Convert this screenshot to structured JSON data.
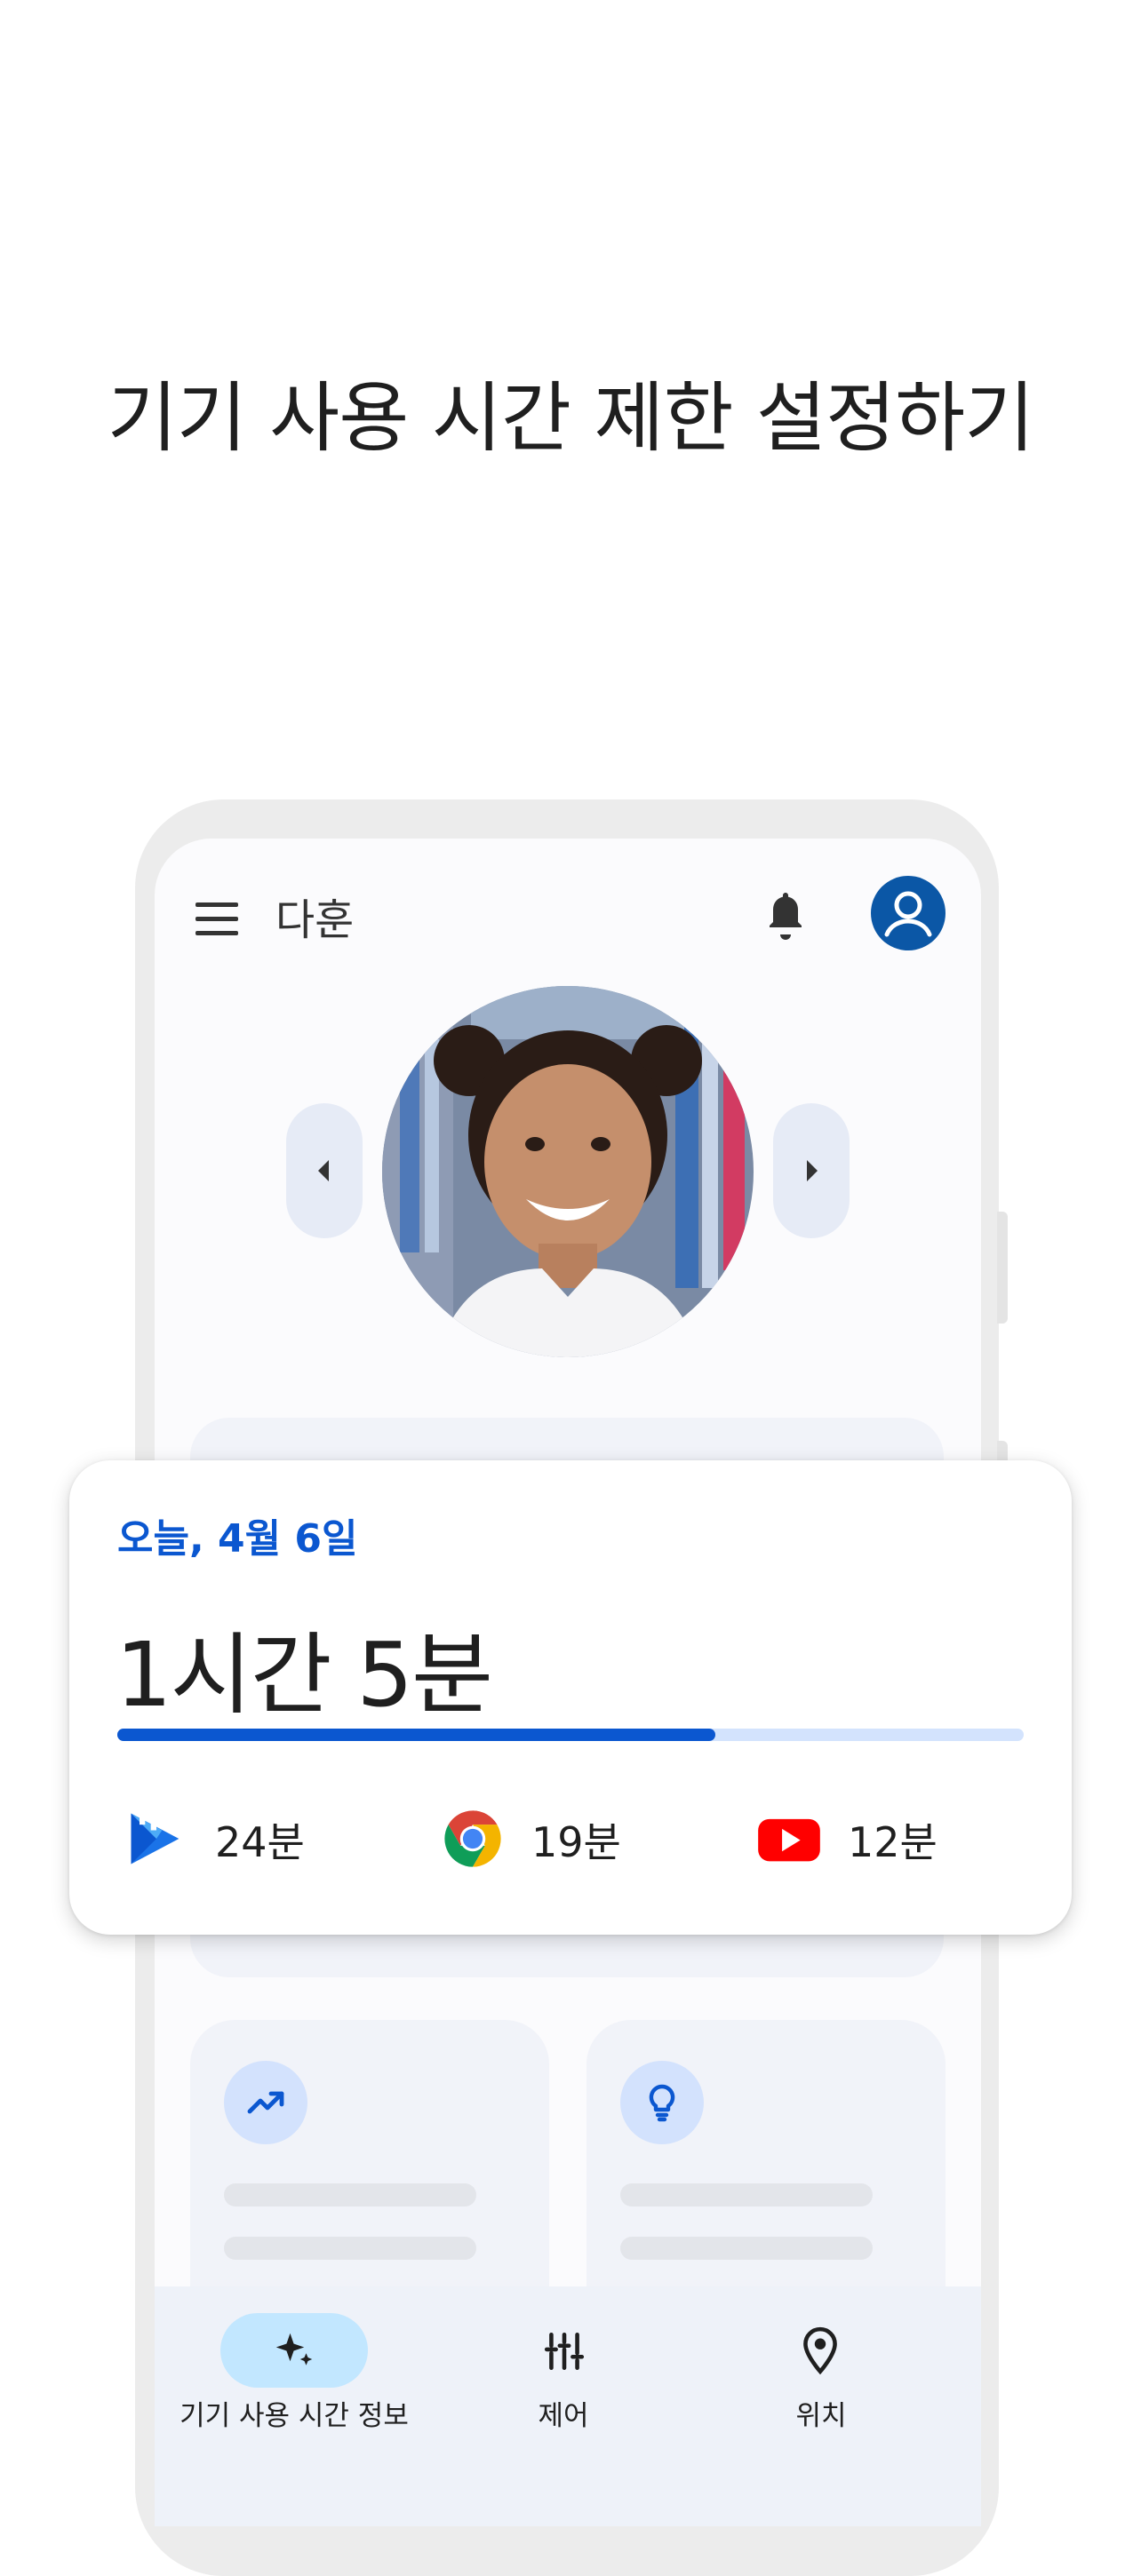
{
  "headline": "기기 사용 시간 제한 설정하기",
  "app_bar": {
    "child_name": "다훈",
    "bell_icon": "bell-icon",
    "account_icon": "account-icon",
    "menu_icon": "menu-icon"
  },
  "summary": {
    "date": "오늘, 4월 6일",
    "total_time": "1시간 5분",
    "progress_fraction": 0.66,
    "apps": [
      {
        "name_icon": "google-play-icon",
        "time": "24분"
      },
      {
        "name_icon": "chrome-icon",
        "time": "19분"
      },
      {
        "name_icon": "youtube-icon",
        "time": "12분"
      }
    ]
  },
  "bottom_nav": {
    "items": [
      {
        "label": "기기 사용 시간 정보",
        "icon": "sparkle-icon",
        "selected": true
      },
      {
        "label": "제어",
        "icon": "tune-icon",
        "selected": false
      },
      {
        "label": "위치",
        "icon": "location-pin-icon",
        "selected": false
      }
    ]
  },
  "colors": {
    "accent": "#0b57d0",
    "account": "#0b57a6",
    "progress_track": "#d3e3fd",
    "nav_pill": "#c2e7ff"
  }
}
